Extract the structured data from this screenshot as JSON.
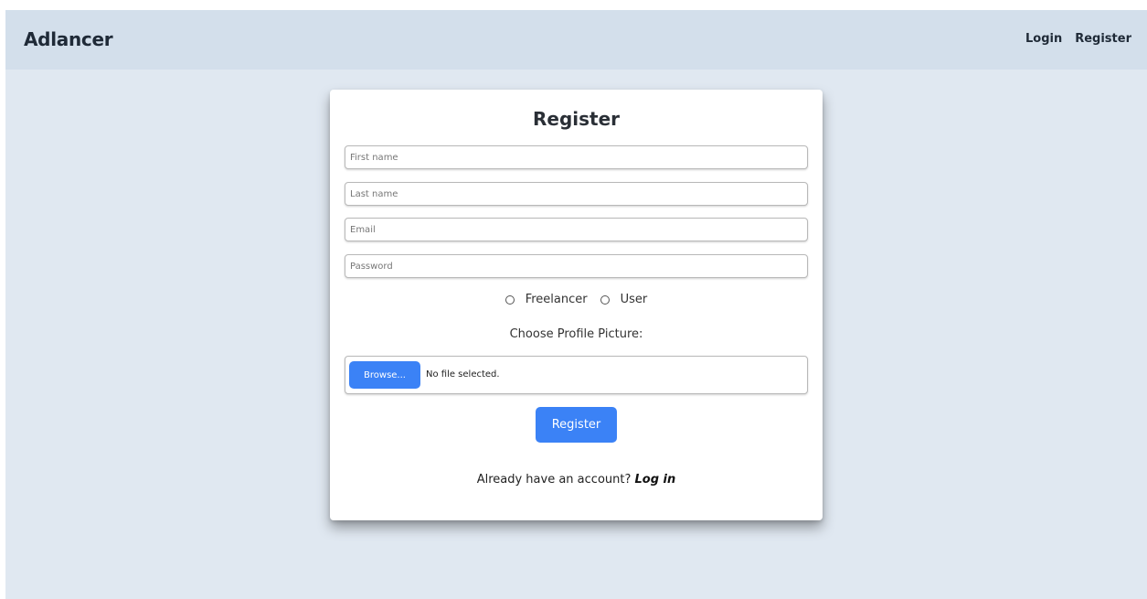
{
  "app": {
    "brand": "Adlancer"
  },
  "nav": {
    "login_label": "Login",
    "register_label": "Register"
  },
  "form": {
    "title": "Register",
    "first_name": {
      "placeholder": "First name",
      "value": ""
    },
    "last_name": {
      "placeholder": "Last name",
      "value": ""
    },
    "email": {
      "placeholder": "Email",
      "value": ""
    },
    "password": {
      "placeholder": "Password",
      "value": ""
    },
    "roles": [
      {
        "label": "Freelancer",
        "selected": false
      },
      {
        "label": "User",
        "selected": false
      }
    ],
    "profile_picture_label": "Choose Profile Picture:",
    "browse_label": "Browse...",
    "file_status": "No file selected.",
    "submit_label": "Register",
    "account_prompt": "Already have an account?",
    "login_link": "Log in"
  },
  "colors": {
    "page_background": "#e0e8f1",
    "navbar_background": "#d3dfeb",
    "primary_button": "#3b82f6",
    "card_background": "#ffffff"
  }
}
